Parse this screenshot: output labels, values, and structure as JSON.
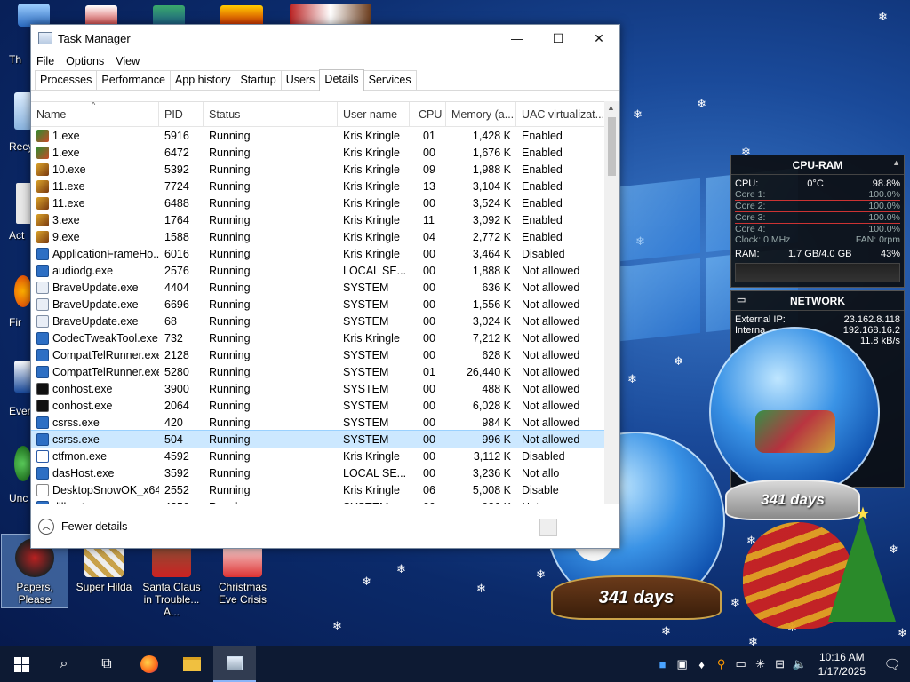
{
  "window": {
    "title": "Task Manager",
    "minimize": "—",
    "maximize": "☐",
    "close": "✕"
  },
  "menu": [
    "File",
    "Options",
    "View"
  ],
  "tabs": [
    "Processes",
    "Performance",
    "App history",
    "Startup",
    "Users",
    "Details",
    "Services"
  ],
  "active_tab": "Details",
  "columns": [
    "Name",
    "PID",
    "Status",
    "User name",
    "CPU",
    "Memory (a...",
    "UAC virtualizat..."
  ],
  "rows": [
    {
      "icon": "tree-icon",
      "name": "1.exe",
      "pid": "5916",
      "status": "Running",
      "user": "Kris Kringle",
      "cpu": "01",
      "mem": "1,428 K",
      "uac": "Enabled"
    },
    {
      "icon": "tree-icon",
      "name": "1.exe",
      "pid": "6472",
      "status": "Running",
      "user": "Kris Kringle",
      "cpu": "00",
      "mem": "1,676 K",
      "uac": "Enabled"
    },
    {
      "icon": "bell-icon",
      "name": "10.exe",
      "pid": "5392",
      "status": "Running",
      "user": "Kris Kringle",
      "cpu": "09",
      "mem": "1,988 K",
      "uac": "Enabled"
    },
    {
      "icon": "bell-icon",
      "name": "11.exe",
      "pid": "7724",
      "status": "Running",
      "user": "Kris Kringle",
      "cpu": "13",
      "mem": "3,104 K",
      "uac": "Enabled"
    },
    {
      "icon": "bell-icon",
      "name": "11.exe",
      "pid": "6488",
      "status": "Running",
      "user": "Kris Kringle",
      "cpu": "00",
      "mem": "3,524 K",
      "uac": "Enabled"
    },
    {
      "icon": "bell-icon",
      "name": "3.exe",
      "pid": "1764",
      "status": "Running",
      "user": "Kris Kringle",
      "cpu": "11",
      "mem": "3,092 K",
      "uac": "Enabled"
    },
    {
      "icon": "bell-icon",
      "name": "9.exe",
      "pid": "1588",
      "status": "Running",
      "user": "Kris Kringle",
      "cpu": "04",
      "mem": "2,772 K",
      "uac": "Enabled"
    },
    {
      "icon": "window-icon",
      "name": "ApplicationFrameHo...",
      "pid": "6016",
      "status": "Running",
      "user": "Kris Kringle",
      "cpu": "00",
      "mem": "3,464 K",
      "uac": "Disabled"
    },
    {
      "icon": "window-icon",
      "name": "audiodg.exe",
      "pid": "2576",
      "status": "Running",
      "user": "LOCAL SE...",
      "cpu": "00",
      "mem": "1,888 K",
      "uac": "Not allowed"
    },
    {
      "icon": "brave-icon",
      "name": "BraveUpdate.exe",
      "pid": "4404",
      "status": "Running",
      "user": "SYSTEM",
      "cpu": "00",
      "mem": "636 K",
      "uac": "Not allowed"
    },
    {
      "icon": "brave-icon",
      "name": "BraveUpdate.exe",
      "pid": "6696",
      "status": "Running",
      "user": "SYSTEM",
      "cpu": "00",
      "mem": "1,556 K",
      "uac": "Not allowed"
    },
    {
      "icon": "brave-icon",
      "name": "BraveUpdate.exe",
      "pid": "68",
      "status": "Running",
      "user": "SYSTEM",
      "cpu": "00",
      "mem": "3,024 K",
      "uac": "Not allowed"
    },
    {
      "icon": "codec-icon",
      "name": "CodecTweakTool.exe",
      "pid": "732",
      "status": "Running",
      "user": "Kris Kringle",
      "cpu": "00",
      "mem": "7,212 K",
      "uac": "Not allowed"
    },
    {
      "icon": "window-icon",
      "name": "CompatTelRunner.exe",
      "pid": "2128",
      "status": "Running",
      "user": "SYSTEM",
      "cpu": "00",
      "mem": "628 K",
      "uac": "Not allowed"
    },
    {
      "icon": "window-icon",
      "name": "CompatTelRunner.exe",
      "pid": "5280",
      "status": "Running",
      "user": "SYSTEM",
      "cpu": "01",
      "mem": "26,440 K",
      "uac": "Not allowed"
    },
    {
      "icon": "console-icon",
      "name": "conhost.exe",
      "pid": "3900",
      "status": "Running",
      "user": "SYSTEM",
      "cpu": "00",
      "mem": "488 K",
      "uac": "Not allowed"
    },
    {
      "icon": "console-icon",
      "name": "conhost.exe",
      "pid": "2064",
      "status": "Running",
      "user": "SYSTEM",
      "cpu": "00",
      "mem": "6,028 K",
      "uac": "Not allowed"
    },
    {
      "icon": "window-icon",
      "name": "csrss.exe",
      "pid": "420",
      "status": "Running",
      "user": "SYSTEM",
      "cpu": "00",
      "mem": "984 K",
      "uac": "Not allowed"
    },
    {
      "icon": "window-icon",
      "name": "csrss.exe",
      "pid": "504",
      "status": "Running",
      "user": "SYSTEM",
      "cpu": "00",
      "mem": "996 K",
      "uac": "Not allowed",
      "selected": true
    },
    {
      "icon": "pen-icon",
      "name": "ctfmon.exe",
      "pid": "4592",
      "status": "Running",
      "user": "Kris Kringle",
      "cpu": "00",
      "mem": "3,112 K",
      "uac": "Disabled"
    },
    {
      "icon": "window-icon",
      "name": "dasHost.exe",
      "pid": "3592",
      "status": "Running",
      "user": "LOCAL SE...",
      "cpu": "00",
      "mem": "3,236 K",
      "uac": "Not allo"
    },
    {
      "icon": "snowflake-icon",
      "name": "DesktopSnowOK_x64...",
      "pid": "2552",
      "status": "Running",
      "user": "Kris Kringle",
      "cpu": "06",
      "mem": "5,008 K",
      "uac": "Disable"
    },
    {
      "icon": "window-icon",
      "name": "dllhost.exe",
      "pid": "4256",
      "status": "Running",
      "user": "SYSTEM",
      "cpu": "00",
      "mem": "936 K",
      "uac": "Not a"
    }
  ],
  "footer": {
    "fewer_details": "Fewer details"
  },
  "desktop_icons": [
    {
      "label": "Papers, Please"
    },
    {
      "label": "Super Hilda"
    },
    {
      "label": "Santa Claus in Trouble... A..."
    },
    {
      "label": "Christmas Eve Crisis"
    }
  ],
  "left_icons": [
    "Th",
    "Recy",
    "Act",
    "Fir",
    "Ever",
    "Unc"
  ],
  "cpu_ram": {
    "title": "CPU-RAM",
    "cpu_label": "CPU:",
    "cpu_temp": "0°C",
    "cpu_pct": "98.8%",
    "cores": [
      {
        "label": "Core 1:",
        "value": "100.0%"
      },
      {
        "label": "Core 2:",
        "value": "100.0%"
      },
      {
        "label": "Core 3:",
        "value": "100.0%"
      },
      {
        "label": "Core 4:",
        "value": "100.0%"
      }
    ],
    "clock": "Clock: 0 MHz",
    "fan": "FAN: 0rpm",
    "ram_label": "RAM:",
    "ram_value": "1.7 GB/4.0 GB",
    "ram_pct": "43%"
  },
  "network": {
    "title": "NETWORK",
    "external_label": "External IP:",
    "external_ip": "23.162.8.118",
    "internal_label": "Interna",
    "internal_ip": "192.168.16.2",
    "rate": "11.8 kB/s"
  },
  "globes": {
    "small_days": "341 days",
    "big_days": "341 days"
  },
  "taskbar": {
    "time": "10:16 AM",
    "date": "1/17/2025"
  }
}
